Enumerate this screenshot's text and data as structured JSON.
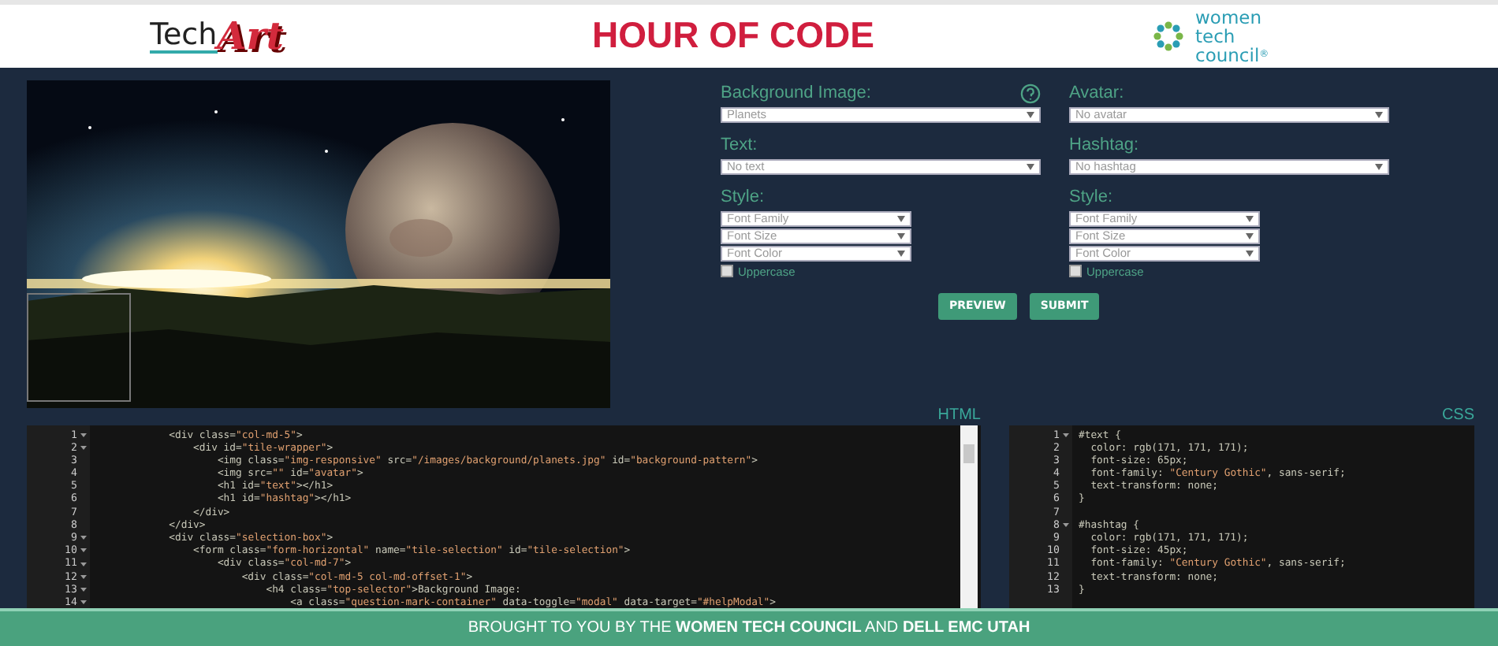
{
  "header": {
    "logo_left": {
      "part1": "Tech",
      "part2": "Art"
    },
    "title": "HOUR OF CODE",
    "logo_right": [
      "women",
      "tech",
      "council"
    ],
    "logo_right_mark": "®"
  },
  "form": {
    "columns": [
      {
        "label": "Background Image:",
        "help": true,
        "value": "Planets",
        "second_label": "Text:",
        "second_value": "No text",
        "style_label": "Style:",
        "styles": [
          "Font Family",
          "Font Size",
          "Font Color"
        ],
        "uppercase": {
          "label": "Uppercase",
          "checked": false
        }
      },
      {
        "label": "Avatar:",
        "value": "No avatar",
        "second_label": "Hashtag:",
        "second_value": "No hashtag",
        "style_label": "Style:",
        "styles": [
          "Font Family",
          "Font Size",
          "Font Color"
        ],
        "uppercase": {
          "label": "Uppercase",
          "checked": false
        }
      }
    ],
    "buttons": [
      "PREVIEW",
      "SUBMIT"
    ]
  },
  "editors": [
    {
      "title": "HTML",
      "scrollbar": true,
      "lines": [
        {
          "n": "1",
          "fold": true,
          "code": "            <div class=\"col-md-5\">"
        },
        {
          "n": "2",
          "fold": true,
          "code": "                <div id=\"tile-wrapper\">"
        },
        {
          "n": "3",
          "fold": false,
          "code": "                    <img class=\"img-responsive\" src=\"/images/background/planets.jpg\" id=\"background-pattern\">"
        },
        {
          "n": "4",
          "fold": false,
          "code": "                    <img src=\"\" id=\"avatar\">"
        },
        {
          "n": "5",
          "fold": false,
          "code": "                    <h1 id=\"text\"></h1>"
        },
        {
          "n": "6",
          "fold": false,
          "code": "                    <h1 id=\"hashtag\"></h1>"
        },
        {
          "n": "7",
          "fold": false,
          "code": "                </div>"
        },
        {
          "n": "8",
          "fold": false,
          "code": "            </div>"
        },
        {
          "n": "9",
          "fold": true,
          "code": "            <div class=\"selection-box\">"
        },
        {
          "n": "10",
          "fold": true,
          "code": "                <form class=\"form-horizontal\" name=\"tile-selection\" id=\"tile-selection\">"
        },
        {
          "n": "11",
          "fold": true,
          "code": "                    <div class=\"col-md-7\">"
        },
        {
          "n": "12",
          "fold": true,
          "code": "                        <div class=\"col-md-5 col-md-offset-1\">"
        },
        {
          "n": "13",
          "fold": true,
          "code": "                            <h4 class=\"top-selector\">Background Image:"
        },
        {
          "n": "14",
          "fold": true,
          "code": "                                <a class=\"question-mark-container\" data-toggle=\"modal\" data-target=\"#helpModal\">"
        }
      ]
    },
    {
      "title": "CSS",
      "lines": [
        {
          "n": "1",
          "fold": true,
          "code": "#text {"
        },
        {
          "n": "2",
          "fold": false,
          "code": "  color: rgb(171, 171, 171);"
        },
        {
          "n": "3",
          "fold": false,
          "code": "  font-size: 65px;"
        },
        {
          "n": "4",
          "fold": false,
          "code": "  font-family: \"Century Gothic\", sans-serif;"
        },
        {
          "n": "5",
          "fold": false,
          "code": "  text-transform: none;"
        },
        {
          "n": "6",
          "fold": false,
          "code": "}"
        },
        {
          "n": "7",
          "fold": false
        },
        {
          "n": "8",
          "fold": true,
          "code": "#hashtag {"
        },
        {
          "n": "9",
          "fold": false,
          "code": "  color: rgb(171, 171, 171);"
        },
        {
          "n": "10",
          "fold": false,
          "code": "  font-size: 45px;"
        },
        {
          "n": "11",
          "fold": false,
          "code": "  font-family: \"Century Gothic\", sans-serif;"
        },
        {
          "n": "12",
          "fold": false,
          "code": "  text-transform: none;"
        },
        {
          "n": "13",
          "fold": false,
          "code": "}"
        }
      ]
    }
  ],
  "footer": "BROUGHT TO YOU BY THE **WOMEN TECH COUNCIL** AND **DELL EMC UTAH**"
}
